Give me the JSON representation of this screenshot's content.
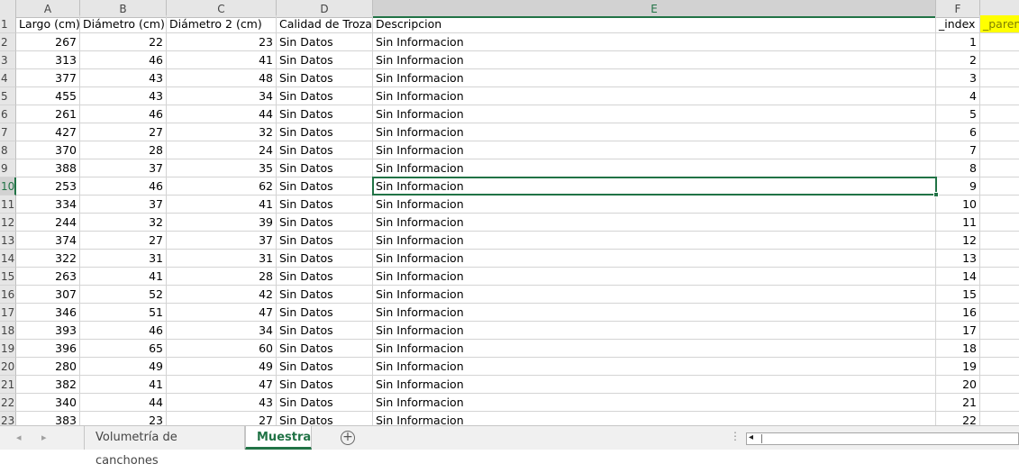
{
  "columns": [
    "A",
    "B",
    "C",
    "D",
    "E",
    "F",
    ""
  ],
  "header_row": {
    "num": "1",
    "A": "Largo (cm)",
    "B": "Diámetro (cm)",
    "C": "Diámetro 2 (cm)",
    "D": "Calidad de Troza",
    "E": "Descripcion",
    "F": "_index",
    "G": "_paren"
  },
  "rows": [
    {
      "num": "2",
      "A": "267",
      "B": "22",
      "C": "23",
      "D": "Sin Datos",
      "E": "Sin Informacion",
      "F": "1"
    },
    {
      "num": "3",
      "A": "313",
      "B": "46",
      "C": "41",
      "D": "Sin Datos",
      "E": "Sin Informacion",
      "F": "2"
    },
    {
      "num": "4",
      "A": "377",
      "B": "43",
      "C": "48",
      "D": "Sin Datos",
      "E": "Sin Informacion",
      "F": "3"
    },
    {
      "num": "5",
      "A": "455",
      "B": "43",
      "C": "34",
      "D": "Sin Datos",
      "E": "Sin Informacion",
      "F": "4"
    },
    {
      "num": "6",
      "A": "261",
      "B": "46",
      "C": "44",
      "D": "Sin Datos",
      "E": "Sin Informacion",
      "F": "5"
    },
    {
      "num": "7",
      "A": "427",
      "B": "27",
      "C": "32",
      "D": "Sin Datos",
      "E": "Sin Informacion",
      "F": "6"
    },
    {
      "num": "8",
      "A": "370",
      "B": "28",
      "C": "24",
      "D": "Sin Datos",
      "E": "Sin Informacion",
      "F": "7"
    },
    {
      "num": "9",
      "A": "388",
      "B": "37",
      "C": "35",
      "D": "Sin Datos",
      "E": "Sin Informacion",
      "F": "8"
    },
    {
      "num": "10",
      "A": "253",
      "B": "46",
      "C": "62",
      "D": "Sin Datos",
      "E": "Sin Informacion",
      "F": "9"
    },
    {
      "num": "11",
      "A": "334",
      "B": "37",
      "C": "41",
      "D": "Sin Datos",
      "E": "Sin Informacion",
      "F": "10"
    },
    {
      "num": "12",
      "A": "244",
      "B": "32",
      "C": "39",
      "D": "Sin Datos",
      "E": "Sin Informacion",
      "F": "11"
    },
    {
      "num": "13",
      "A": "374",
      "B": "27",
      "C": "37",
      "D": "Sin Datos",
      "E": "Sin Informacion",
      "F": "12"
    },
    {
      "num": "14",
      "A": "322",
      "B": "31",
      "C": "31",
      "D": "Sin Datos",
      "E": "Sin Informacion",
      "F": "13"
    },
    {
      "num": "15",
      "A": "263",
      "B": "41",
      "C": "28",
      "D": "Sin Datos",
      "E": "Sin Informacion",
      "F": "14"
    },
    {
      "num": "16",
      "A": "307",
      "B": "52",
      "C": "42",
      "D": "Sin Datos",
      "E": "Sin Informacion",
      "F": "15"
    },
    {
      "num": "17",
      "A": "346",
      "B": "51",
      "C": "47",
      "D": "Sin Datos",
      "E": "Sin Informacion",
      "F": "16"
    },
    {
      "num": "18",
      "A": "393",
      "B": "46",
      "C": "34",
      "D": "Sin Datos",
      "E": "Sin Informacion",
      "F": "17"
    },
    {
      "num": "19",
      "A": "396",
      "B": "65",
      "C": "60",
      "D": "Sin Datos",
      "E": "Sin Informacion",
      "F": "18"
    },
    {
      "num": "20",
      "A": "280",
      "B": "49",
      "C": "49",
      "D": "Sin Datos",
      "E": "Sin Informacion",
      "F": "19"
    },
    {
      "num": "21",
      "A": "382",
      "B": "41",
      "C": "47",
      "D": "Sin Datos",
      "E": "Sin Informacion",
      "F": "20"
    },
    {
      "num": "22",
      "A": "340",
      "B": "44",
      "C": "43",
      "D": "Sin Datos",
      "E": "Sin Informacion",
      "F": "21"
    },
    {
      "num": "23",
      "A": "383",
      "B": "23",
      "C": "27",
      "D": "Sin Datos",
      "E": "Sin Informacion",
      "F": "22"
    }
  ],
  "selection": {
    "column": "E",
    "row": "10"
  },
  "sheet_tabs": [
    {
      "label": "Volumetría de canchones",
      "active": false
    },
    {
      "label": "Muestra",
      "active": true
    }
  ],
  "icons": {
    "prev_sheet": "◂",
    "next_sheet": "▸",
    "add_sheet": "+",
    "scroll_left": "◂",
    "more": "⋮"
  },
  "colors": {
    "accent": "#217346",
    "highlight": "#ffff00"
  }
}
